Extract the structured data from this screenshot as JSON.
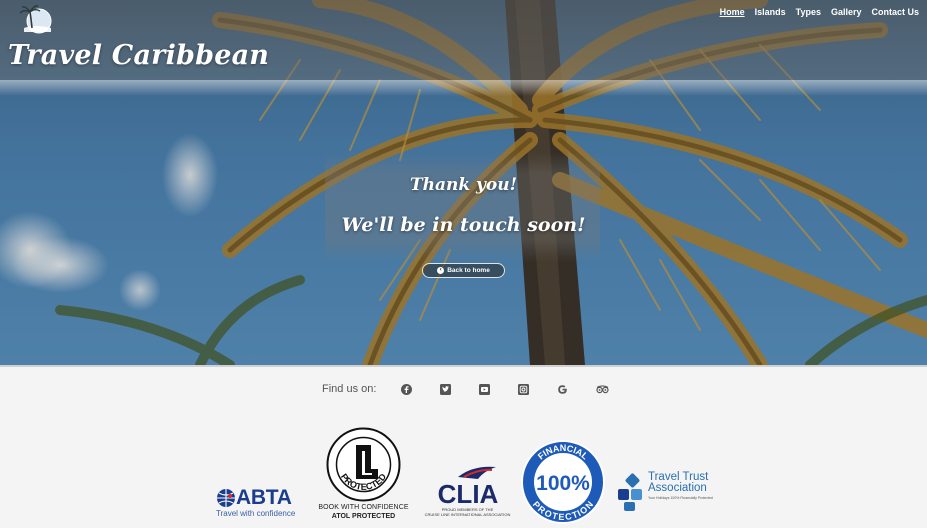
{
  "brand": {
    "name": "Travel Caribbean"
  },
  "nav": {
    "items": [
      {
        "label": "Home",
        "active": true
      },
      {
        "label": "Islands",
        "active": false
      },
      {
        "label": "Types",
        "active": false
      },
      {
        "label": "Gallery",
        "active": false
      },
      {
        "label": "Contact Us",
        "active": false
      }
    ]
  },
  "hero": {
    "line1": "Thank you!",
    "line2": "We'll be in touch soon!",
    "back_button": "Back to home"
  },
  "footer": {
    "find_us_label": "Find us on:",
    "social_icons": [
      "facebook-icon",
      "twitter-icon",
      "youtube-icon",
      "instagram-icon",
      "google-icon",
      "tripadvisor-icon"
    ],
    "logos": {
      "abta": {
        "title": "ABTA",
        "subtitle": "Travel with confidence"
      },
      "atol": {
        "ring": "PROTECTED",
        "caption1": "BOOK WITH CONFIDENCE",
        "caption2": "ATOL PROTECTED"
      },
      "clia": {
        "title": "CLIA",
        "subtitle1": "PROUD MEMBERS OF THE",
        "subtitle2": "CRUISE LINE INTERNATIONAL ASSOCIATION"
      },
      "financial": {
        "top": "FINANCIAL",
        "center": "100%",
        "bottom": "PROTECTION"
      },
      "tta": {
        "line1": "Travel Trust",
        "line2": "Association",
        "small": "Your Holidays 100% Financially Protected"
      }
    }
  },
  "colors": {
    "abta_blue": "#1a3d8f",
    "financial_blue": "#1e5bb8",
    "tta_blue": "#2a6fb0"
  }
}
